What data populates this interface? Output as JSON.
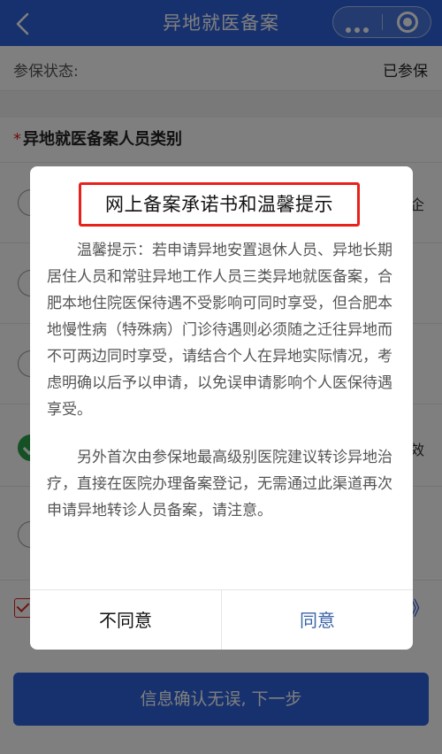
{
  "header": {
    "title": "异地就医备案"
  },
  "page": {
    "status_label": "参保状态:",
    "status_value": "已参保",
    "section_title": "异地就医备案人员类别",
    "required_mark": "*",
    "options": [
      {
        "text": "企",
        "checked": false
      },
      {
        "text": "",
        "checked": false
      },
      {
        "text": "",
        "checked": false
      },
      {
        "text": "效",
        "checked": true
      },
      {
        "text": "",
        "checked": false
      }
    ],
    "more_chevron": "》",
    "next_button": "信息确认无误, 下一步"
  },
  "modal": {
    "title": "网上备案承诺书和温馨提示",
    "paragraph1": "温馨提示：若申请异地安置退休人员、异地长期居住人员和常驻异地工作人员三类异地就医备案，合肥本地住院医保待遇不受影响可同时享受，但合肥本地慢性病（特殊病）门诊待遇则必须随之迁往异地而不可两边同时享受，请结合个人在异地实际情况，考虑明确以后予以申请，以免误申请影响个人医保待遇享受。",
    "paragraph2": "另外首次由参保地最高级别医院建议转诊异地治疗，直接在医院办理备案登记，无需通过此渠道再次申请异地转诊人员备案，请注意。",
    "disagree": "不同意",
    "agree": "同意"
  },
  "colors": {
    "primary": "#2f63dc",
    "highlight_border": "#e8221a",
    "agree_text": "#3a64a8",
    "check_green": "#2aa34a"
  },
  "icons": {
    "back": "chevron-left-icon",
    "more": "more-dots-icon",
    "close": "target-circle-icon"
  }
}
